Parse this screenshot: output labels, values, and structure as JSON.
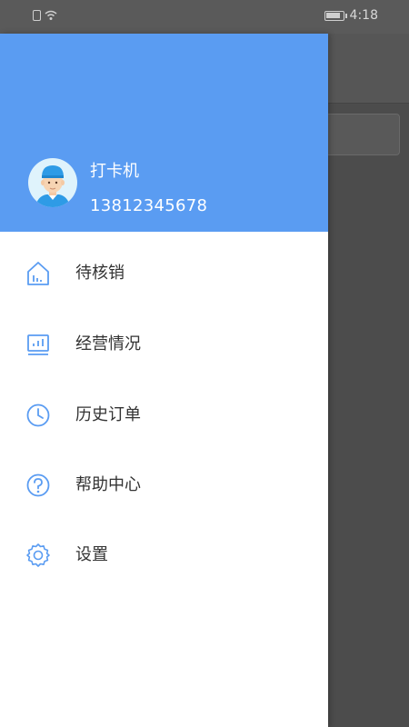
{
  "status_bar": {
    "time": "4:18",
    "icons": [
      "sim-icon",
      "wifi-icon",
      "battery-icon"
    ]
  },
  "drawer": {
    "header_color": "#5a9cf2",
    "user": {
      "name": "打卡机",
      "phone": "13812345678",
      "avatar": "worker-avatar"
    },
    "menu": [
      {
        "label": "待核销",
        "icon": "home-icon"
      },
      {
        "label": "经营情况",
        "icon": "chart-icon"
      },
      {
        "label": "历史订单",
        "icon": "clock-icon"
      },
      {
        "label": "帮助中心",
        "icon": "help-icon"
      },
      {
        "label": "设置",
        "icon": "settings-icon"
      }
    ]
  },
  "theme": {
    "icon_color": "#5a9cf2",
    "text_color": "#333333",
    "overlay_color": "#4a4a4a"
  }
}
